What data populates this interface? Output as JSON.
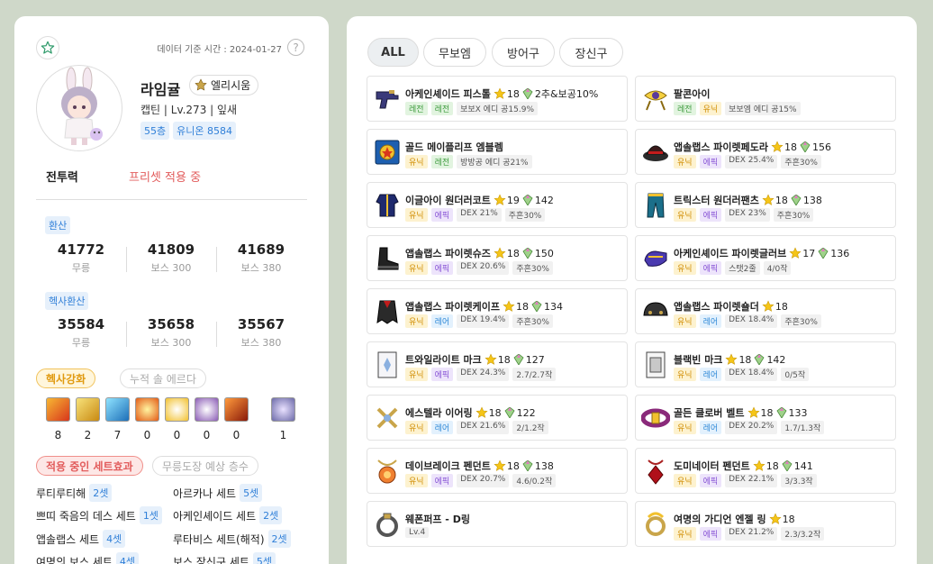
{
  "character": {
    "date_label": "데이터 기준 시간 : 2024-01-27",
    "help": "?",
    "name": "라임귤",
    "guild": "엘리시움",
    "job_line": "캡틴 | Lv.273 | 잎새",
    "floor": "55층",
    "union": "유니온 8584",
    "power_label": "전투력",
    "preset_label": "프리셋 적용 중"
  },
  "stats": {
    "arcane_title": "환산",
    "arcane": [
      {
        "value": "41772",
        "label": "무릉"
      },
      {
        "value": "41809",
        "label": "보스 300"
      },
      {
        "value": "41689",
        "label": "보스 380"
      }
    ],
    "hexa_title": "헥사환산",
    "hexa": [
      {
        "value": "35584",
        "label": "무릉"
      },
      {
        "value": "35658",
        "label": "보스 300"
      },
      {
        "value": "35567",
        "label": "보스 380"
      }
    ]
  },
  "hexa_section": {
    "toggle_on": "헥사강화",
    "toggle_off": "누적 솔 에르다",
    "levels": [
      "8",
      "2",
      "7",
      "0",
      "0",
      "0",
      "0",
      "1"
    ]
  },
  "set_section": {
    "toggle_on": "적용 중인 세트효과",
    "toggle_off": "무릉도장 예상 층수",
    "sets": [
      {
        "name": "루티루티해",
        "count": "2셋"
      },
      {
        "name": "아르카나 세트",
        "count": "5셋"
      },
      {
        "name": "쁘띠 죽음의 데스 세트",
        "count": "1셋"
      },
      {
        "name": "아케인셰이드 세트",
        "count": "2셋"
      },
      {
        "name": "앱솔랩스 세트",
        "count": "4셋"
      },
      {
        "name": "루타비스 세트(해적)",
        "count": "2셋"
      },
      {
        "name": "여명의 보스 세트",
        "count": "4셋"
      },
      {
        "name": "보스 장신구 세트",
        "count": "5셋"
      }
    ]
  },
  "tabs": [
    "ALL",
    "무보엠",
    "방어구",
    "장신구"
  ],
  "items": [
    {
      "name": "아케인셰이드 피스톨",
      "star": "18",
      "pot": "2추&보공10%",
      "tags": [
        [
          "레전",
          "legend"
        ],
        [
          "레전",
          "legend"
        ],
        [
          "보보X 에디 공15.9%",
          "opt"
        ]
      ],
      "icon": "gun"
    },
    {
      "name": "팔콘아이",
      "star": "",
      "pot": "",
      "tags": [
        [
          "레전",
          "legend"
        ],
        [
          "유닉",
          "unique"
        ],
        [
          "보보엠 에디 공15%",
          "opt"
        ]
      ],
      "icon": "eye"
    },
    {
      "name": "골드 메이플리프 엠블렘",
      "star": "",
      "pot": "",
      "tags": [
        [
          "유닉",
          "unique"
        ],
        [
          "레전",
          "legend"
        ],
        [
          "방방공 에디 공21%",
          "opt"
        ]
      ],
      "icon": "emblem"
    },
    {
      "name": "앱솔랩스 파이렛페도라",
      "star": "18",
      "pot": "156",
      "tags": [
        [
          "유닉",
          "unique"
        ],
        [
          "에픽",
          "epic"
        ],
        [
          "DEX 25.4%",
          "opt"
        ],
        [
          "주흔30%",
          "opt"
        ]
      ],
      "icon": "hat"
    },
    {
      "name": "이글아이 원더러코트",
      "star": "19",
      "pot": "142",
      "tags": [
        [
          "유닉",
          "unique"
        ],
        [
          "에픽",
          "epic"
        ],
        [
          "DEX 21%",
          "opt"
        ],
        [
          "주흔30%",
          "opt"
        ]
      ],
      "icon": "coat"
    },
    {
      "name": "트릭스터 원더러팬츠",
      "star": "18",
      "pot": "138",
      "tags": [
        [
          "유닉",
          "unique"
        ],
        [
          "에픽",
          "epic"
        ],
        [
          "DEX 23%",
          "opt"
        ],
        [
          "주흔30%",
          "opt"
        ]
      ],
      "icon": "pants"
    },
    {
      "name": "앱솔랩스 파이렛슈즈",
      "star": "18",
      "pot": "150",
      "tags": [
        [
          "유닉",
          "unique"
        ],
        [
          "에픽",
          "epic"
        ],
        [
          "DEX 20.6%",
          "opt"
        ],
        [
          "주흔30%",
          "opt"
        ]
      ],
      "icon": "shoes"
    },
    {
      "name": "아케인셰이드 파이렛글러브",
      "star": "17",
      "pot": "136",
      "tags": [
        [
          "유닉",
          "unique"
        ],
        [
          "에픽",
          "epic"
        ],
        [
          "스탯2줄",
          "opt"
        ],
        [
          "4/0작",
          "opt"
        ]
      ],
      "icon": "glove"
    },
    {
      "name": "앱솔랩스 파이렛케이프",
      "star": "18",
      "pot": "134",
      "tags": [
        [
          "유닉",
          "unique"
        ],
        [
          "레어",
          "rare"
        ],
        [
          "DEX 19.4%",
          "opt"
        ],
        [
          "주흔30%",
          "opt"
        ]
      ],
      "icon": "cape"
    },
    {
      "name": "앱솔랩스 파이렛숄더",
      "star": "18",
      "pot": "",
      "tags": [
        [
          "유닉",
          "unique"
        ],
        [
          "레어",
          "rare"
        ],
        [
          "DEX 18.4%",
          "opt"
        ],
        [
          "주흔30%",
          "opt"
        ]
      ],
      "icon": "shoulder"
    },
    {
      "name": "트와일라이트 마크",
      "star": "18",
      "pot": "127",
      "tags": [
        [
          "유닉",
          "unique"
        ],
        [
          "에픽",
          "epic"
        ],
        [
          "DEX 24.3%",
          "opt"
        ],
        [
          "2.7/2.7작",
          "opt"
        ]
      ],
      "icon": "mark"
    },
    {
      "name": "블랙빈 마크",
      "star": "18",
      "pot": "142",
      "tags": [
        [
          "유닉",
          "unique"
        ],
        [
          "레어",
          "rare"
        ],
        [
          "DEX 18.4%",
          "opt"
        ],
        [
          "0/5작",
          "opt"
        ]
      ],
      "icon": "mark2"
    },
    {
      "name": "에스텔라 이어링",
      "star": "18",
      "pot": "122",
      "tags": [
        [
          "유닉",
          "unique"
        ],
        [
          "레어",
          "rare"
        ],
        [
          "DEX 21.6%",
          "opt"
        ],
        [
          "2/1.2작",
          "opt"
        ]
      ],
      "icon": "earring"
    },
    {
      "name": "골든 클로버 벨트",
      "star": "18",
      "pot": "133",
      "tags": [
        [
          "유닉",
          "unique"
        ],
        [
          "레어",
          "rare"
        ],
        [
          "DEX 20.2%",
          "opt"
        ],
        [
          "1.7/1.3작",
          "opt"
        ]
      ],
      "icon": "belt"
    },
    {
      "name": "데이브레이크 펜던트",
      "star": "18",
      "pot": "138",
      "tags": [
        [
          "유닉",
          "unique"
        ],
        [
          "에픽",
          "epic"
        ],
        [
          "DEX 20.7%",
          "opt"
        ],
        [
          "4.6/0.2작",
          "opt"
        ]
      ],
      "icon": "pendant"
    },
    {
      "name": "도미네이터 펜던트",
      "star": "18",
      "pot": "141",
      "tags": [
        [
          "유닉",
          "unique"
        ],
        [
          "에픽",
          "epic"
        ],
        [
          "DEX 22.1%",
          "opt"
        ],
        [
          "3/3.3작",
          "opt"
        ]
      ],
      "icon": "pendant2"
    },
    {
      "name": "웨폰퍼프 - D링",
      "star": "",
      "pot": "",
      "tags": [
        [
          "Lv.4",
          "opt"
        ]
      ],
      "icon": "ring"
    },
    {
      "name": "여명의 가디언 엔젤 링",
      "star": "18",
      "pot": "",
      "tags": [
        [
          "유닉",
          "unique"
        ],
        [
          "에픽",
          "epic"
        ],
        [
          "DEX 21.2%",
          "opt"
        ],
        [
          "2.3/3.2작",
          "opt"
        ]
      ],
      "icon": "ring2"
    }
  ]
}
